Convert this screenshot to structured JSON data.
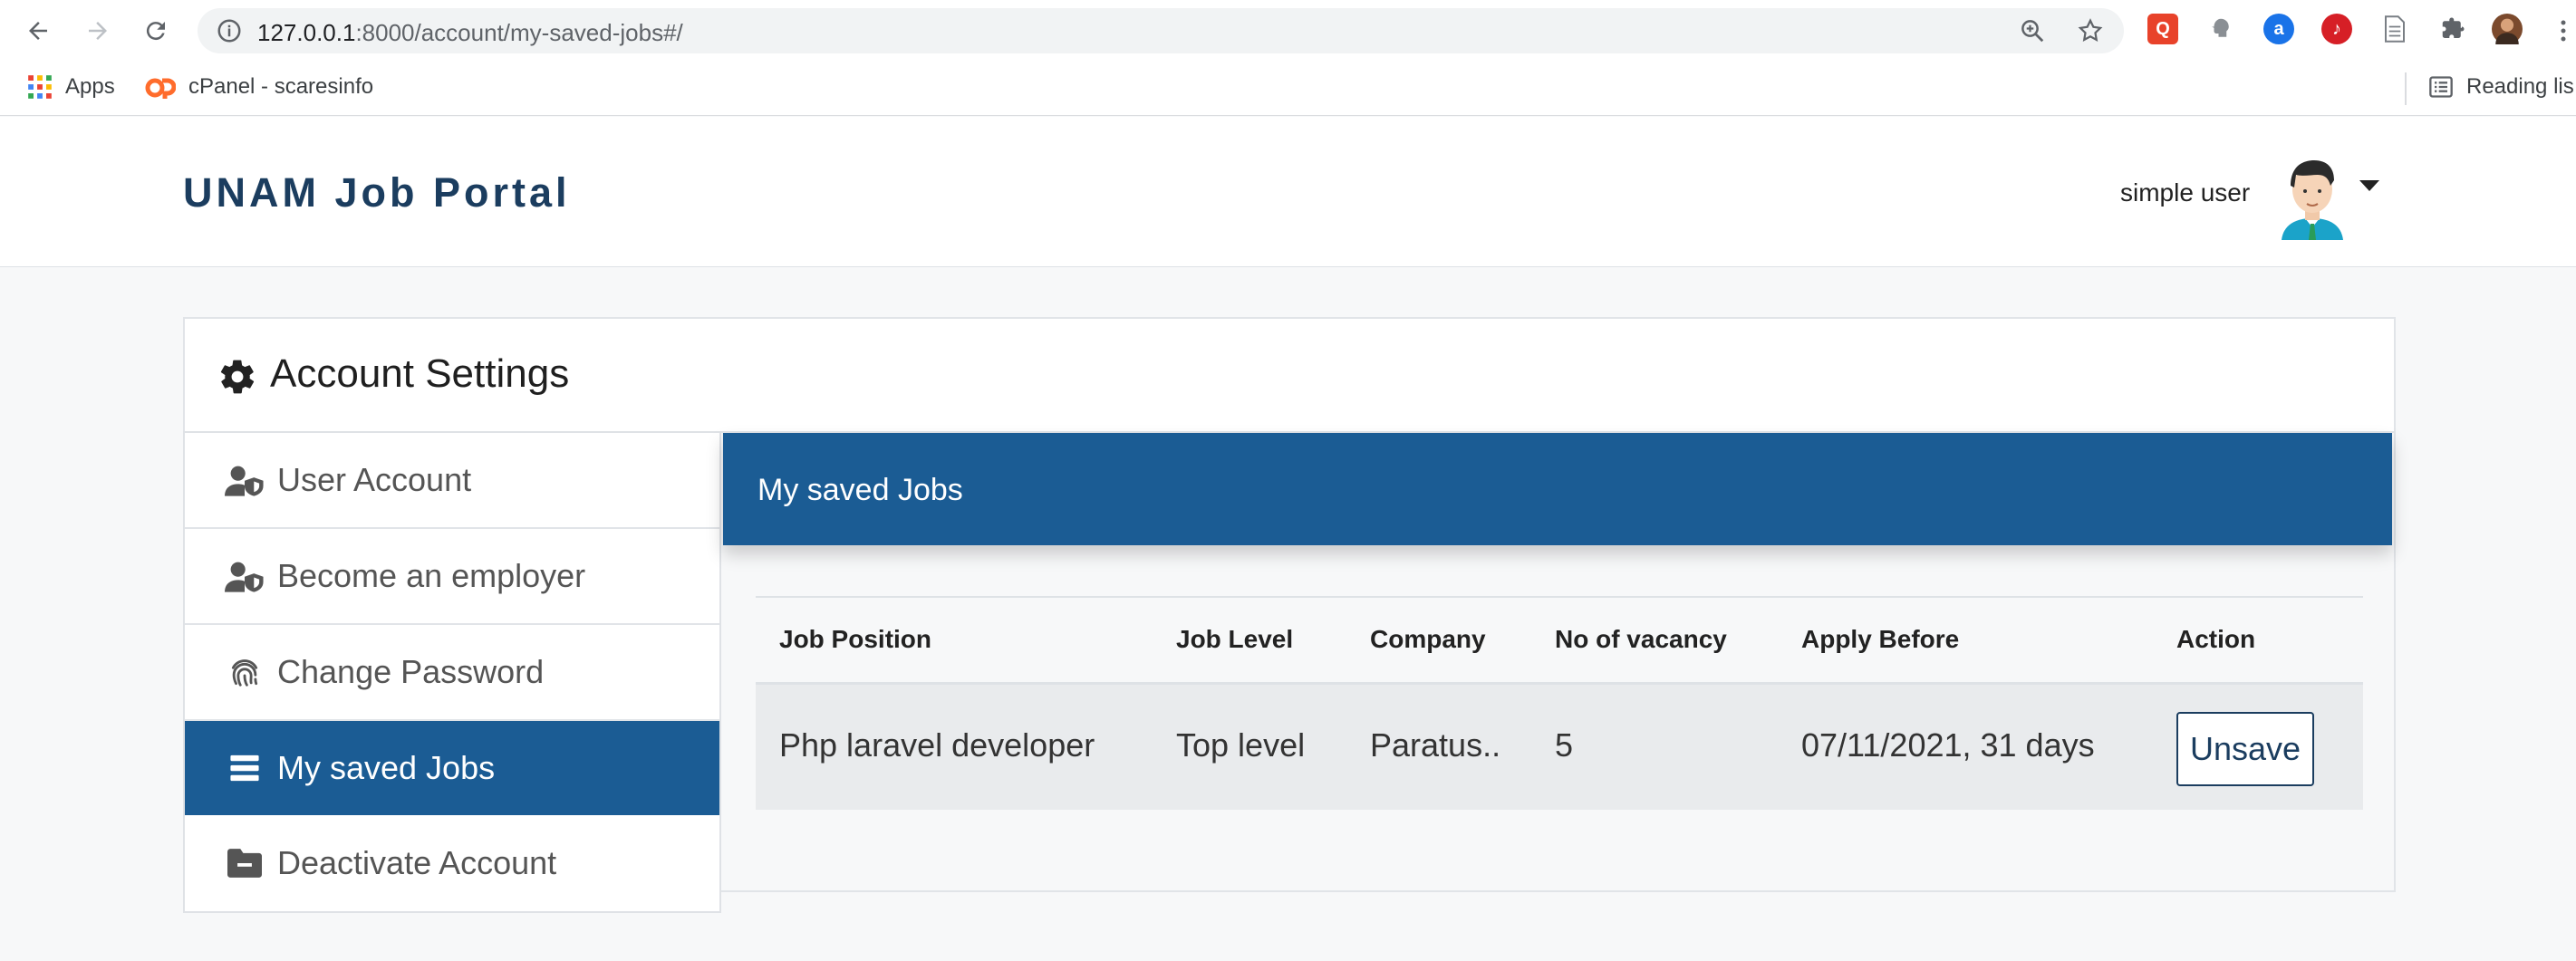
{
  "browser": {
    "url_host": "127.0.0.1",
    "url_rest": ":8000/account/my-saved-jobs#/",
    "bookmarks": [
      {
        "label": "Apps"
      },
      {
        "label": "cPanel - scaresinfo"
      }
    ],
    "reading_list": "Reading lis"
  },
  "header": {
    "brand": "UNAM Job Portal",
    "user_name": "simple user"
  },
  "panel": {
    "title": "Account Settings"
  },
  "sidebar": {
    "items": [
      {
        "label": "User Account",
        "icon": "user-shield-icon"
      },
      {
        "label": "Become an employer",
        "icon": "user-shield-icon"
      },
      {
        "label": "Change Password",
        "icon": "fingerprint-icon"
      },
      {
        "label": "My saved Jobs",
        "icon": "list-icon",
        "active": true
      },
      {
        "label": "Deactivate Account",
        "icon": "folder-minus-icon"
      }
    ]
  },
  "content": {
    "title": "My saved Jobs",
    "table": {
      "headers": [
        "Job Position",
        "Job Level",
        "Company",
        "No of vacancy",
        "Apply Before",
        "Action"
      ],
      "rows": [
        {
          "position": "Php laravel developer",
          "level": "Top level",
          "company": "Paratus..",
          "vacancies": "5",
          "apply_before": "07/11/2021, 31 days",
          "action": "Unsave"
        }
      ]
    }
  },
  "colors": {
    "primary": "#1b5c94",
    "brand": "#1b3d5f",
    "row_bg": "#e9ebed"
  }
}
